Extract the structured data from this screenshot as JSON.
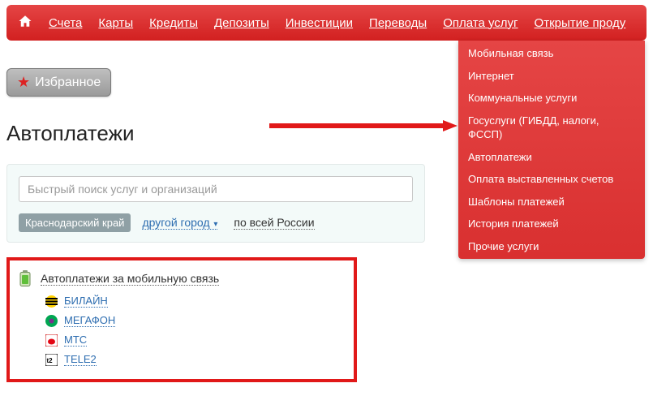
{
  "nav": {
    "items": [
      {
        "label": "Счета"
      },
      {
        "label": "Карты"
      },
      {
        "label": "Кредиты"
      },
      {
        "label": "Депозиты"
      },
      {
        "label": "Инвестиции"
      },
      {
        "label": "Переводы"
      },
      {
        "label": "Оплата услуг"
      },
      {
        "label": "Открытие проду"
      }
    ]
  },
  "dropdown": {
    "items": [
      {
        "label": "Мобильная связь"
      },
      {
        "label": "Интернет"
      },
      {
        "label": "Коммунальные услуги"
      },
      {
        "label": "Госуслуги (ГИБДД, налоги, ФССП)"
      },
      {
        "label": "Автоплатежи"
      },
      {
        "label": "Оплата выставленных счетов"
      },
      {
        "label": "Шаблоны платежей"
      },
      {
        "label": "История платежей"
      },
      {
        "label": "Прочие услуги"
      }
    ]
  },
  "favorites_label": "Избранное",
  "page_title": "Автоплатежи",
  "search": {
    "placeholder": "Быстрый поиск услуг и организаций"
  },
  "region": {
    "current": "Краснодарский край",
    "other_city": "другой город",
    "all_russia": "по всей России"
  },
  "providers": {
    "group_title": "Автоплатежи за мобильную связь",
    "items": [
      {
        "label": "БИЛАЙН",
        "icon": "beeline"
      },
      {
        "label": "МЕГАФОН",
        "icon": "megafon"
      },
      {
        "label": "МТС",
        "icon": "mts"
      },
      {
        "label": "TELE2",
        "icon": "tele2"
      }
    ]
  }
}
